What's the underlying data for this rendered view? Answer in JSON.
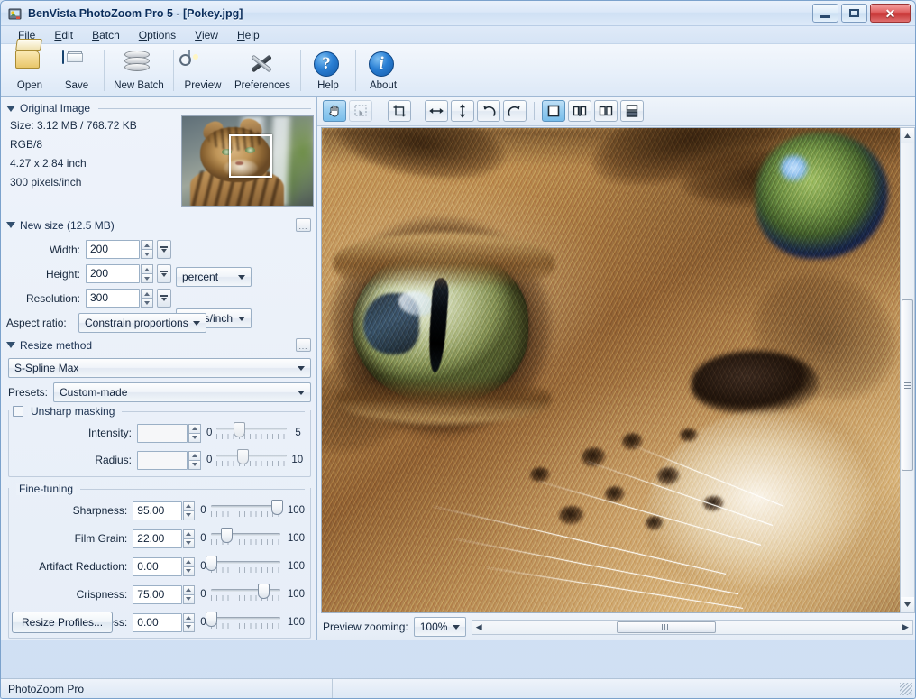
{
  "window": {
    "title": "BenVista PhotoZoom Pro 5 - [Pokey.jpg]",
    "minimize_label": "Minimize",
    "maximize_label": "Maximize",
    "close_label": "✕"
  },
  "menubar": [
    {
      "label": "File",
      "accel": "F"
    },
    {
      "label": "Edit",
      "accel": "E"
    },
    {
      "label": "Batch",
      "accel": "B"
    },
    {
      "label": "Options",
      "accel": "O"
    },
    {
      "label": "View",
      "accel": "V"
    },
    {
      "label": "Help",
      "accel": "H"
    }
  ],
  "toolbar": [
    {
      "label": "Open",
      "icon": "open-folder-icon"
    },
    {
      "label": "Save",
      "icon": "floppy-disk-icon"
    },
    {
      "label": "New Batch",
      "icon": "batch-stack-icon"
    },
    {
      "label": "Preview",
      "icon": "preview-image-icon"
    },
    {
      "label": "Preferences",
      "icon": "tools-icon"
    },
    {
      "label": "Help",
      "icon": "help-question-icon"
    },
    {
      "label": "About",
      "icon": "about-info-icon"
    }
  ],
  "original_image": {
    "group_title": "Original Image",
    "size": "Size: 3.12 MB / 768.72 KB",
    "color_mode": "RGB/8",
    "dimensions": "4.27 x 2.84 inch",
    "resolution": "300 pixels/inch"
  },
  "new_size": {
    "group_title": "New size (12.5 MB)",
    "options_label": "...",
    "width": {
      "label": "Width:",
      "value": "200"
    },
    "height": {
      "label": "Height:",
      "value": "200"
    },
    "resolution": {
      "label": "Resolution:",
      "value": "300"
    },
    "size_unit": "percent",
    "resolution_unit": "pixels/inch",
    "aspect_ratio_label": "Aspect ratio:",
    "aspect_ratio_value": "Constrain proportions"
  },
  "resize_method": {
    "group_title": "Resize method",
    "options_label": "...",
    "method": "S-Spline Max",
    "presets_label": "Presets:",
    "presets_value": "Custom-made"
  },
  "unsharp_masking": {
    "title": "Unsharp masking",
    "checked": false,
    "rows": [
      {
        "label": "Intensity:",
        "value": "",
        "min": "0",
        "max": "5",
        "pct": 31
      },
      {
        "label": "Radius:",
        "value": "",
        "min": "0",
        "max": "10",
        "pct": 37
      }
    ]
  },
  "fine_tuning": {
    "title": "Fine-tuning",
    "rows": [
      {
        "label": "Sharpness:",
        "value": "95.00",
        "min": "0",
        "max": "100",
        "pct": 95
      },
      {
        "label": "Film Grain:",
        "value": "22.00",
        "min": "0",
        "max": "100",
        "pct": 22
      },
      {
        "label": "Artifact Reduction:",
        "value": "0.00",
        "min": "0",
        "max": "100",
        "pct": 0
      },
      {
        "label": "Crispness:",
        "value": "75.00",
        "min": "0",
        "max": "100",
        "pct": 75
      },
      {
        "label": "Vividness:",
        "value": "0.00",
        "min": "0",
        "max": "100",
        "pct": 0
      }
    ]
  },
  "resize_profiles_button": "Resize Profiles...",
  "preview_toolbar": [
    {
      "name": "hand-tool",
      "active": true
    },
    {
      "name": "marquee-select-tool",
      "active": false
    },
    {
      "name": "crop-tool",
      "active": false
    },
    {
      "name": "flip-horizontal",
      "active": false
    },
    {
      "name": "flip-vertical",
      "active": false
    },
    {
      "name": "rotate-left",
      "active": false
    },
    {
      "name": "rotate-right",
      "active": false
    },
    {
      "name": "view-single",
      "active": true
    },
    {
      "name": "view-split",
      "active": false
    },
    {
      "name": "view-side-by-side",
      "active": false
    },
    {
      "name": "view-stacked",
      "active": false
    }
  ],
  "preview_bottom": {
    "zoom_label": "Preview zooming:",
    "zoom_value": "100%"
  },
  "status_bar": {
    "text": "PhotoZoom Pro"
  },
  "colors": {
    "accent_blue": "#94ccf0",
    "close_red": "#c63232",
    "panel_bg": "#eef3fa",
    "window_border": "#7ba2cc"
  }
}
